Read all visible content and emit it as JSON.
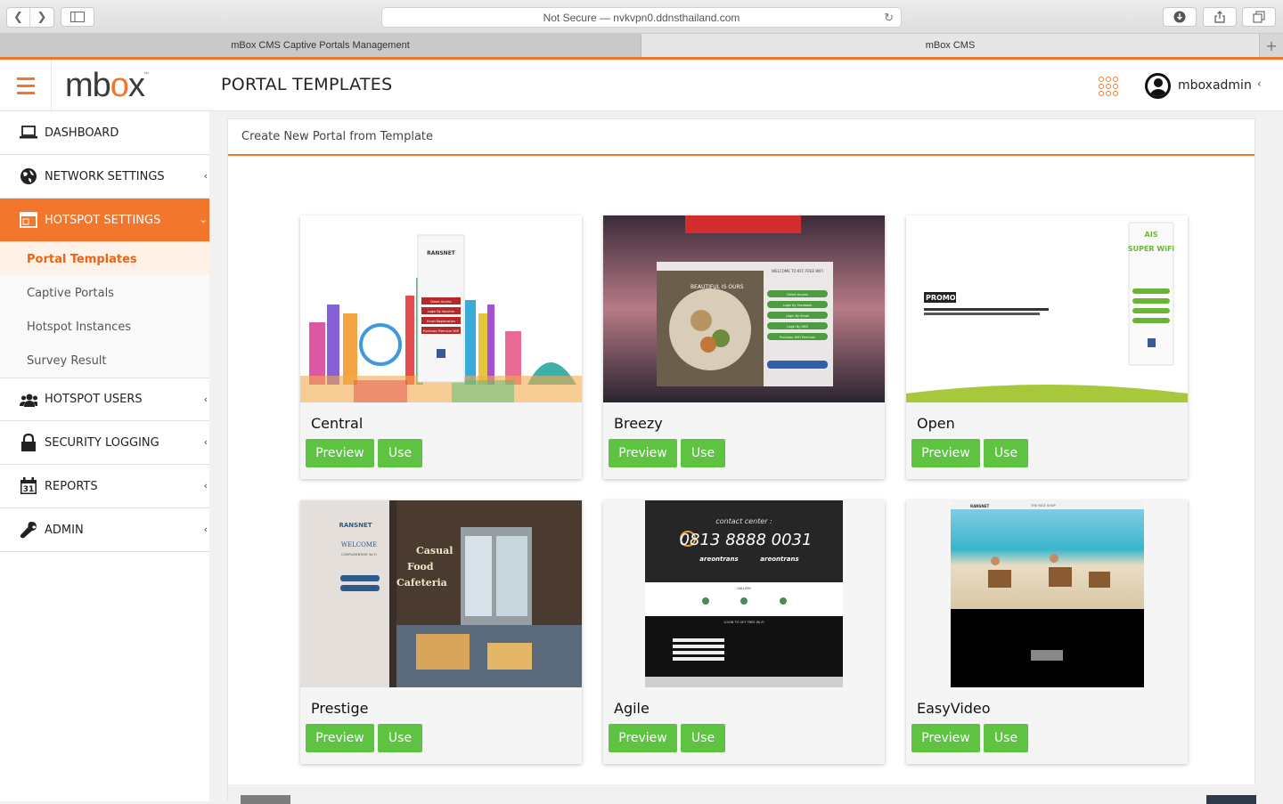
{
  "browser": {
    "url": "Not Secure — nvkvpn0.ddnsthailand.com",
    "tabs": [
      {
        "label": "mBox CMS Captive Portals Management"
      },
      {
        "label": "mBox CMS"
      }
    ]
  },
  "header": {
    "logo": {
      "pre": "mb",
      "o": "o",
      "post": "x",
      "tm": "™"
    },
    "title": "PORTAL TEMPLATES",
    "username": "mboxadmin"
  },
  "sidebar": {
    "items": [
      {
        "label": "DASHBOARD",
        "icon": "laptop-icon"
      },
      {
        "label": "NETWORK SETTINGS",
        "icon": "globe-icon"
      },
      {
        "label": "HOTSPOT SETTINGS",
        "icon": "window-icon"
      },
      {
        "label": "HOTSPOT USERS",
        "icon": "users-icon"
      },
      {
        "label": "SECURITY LOGGING",
        "icon": "lock-icon"
      },
      {
        "label": "REPORTS",
        "icon": "calendar-icon",
        "icon_text": "31"
      },
      {
        "label": "ADMIN",
        "icon": "wrench-icon"
      }
    ],
    "submenu": [
      {
        "label": "Portal Templates"
      },
      {
        "label": "Captive Portals"
      },
      {
        "label": "Hotspot Instances"
      },
      {
        "label": "Survey Result"
      }
    ]
  },
  "panel": {
    "heading": "Create New Portal from Template"
  },
  "templates": [
    {
      "name": "Central",
      "preview": "Preview",
      "use": "Use",
      "thumb": {
        "title": "RANSNET",
        "buttons": [
          "Direct Access",
          "Login By Voucher",
          "Email Registration",
          "Purchase Premium WiFi"
        ]
      }
    },
    {
      "name": "Breezy",
      "preview": "Preview",
      "use": "Use",
      "thumb": {
        "title": "WELCOME TO KFC FREE WIFI",
        "banner": "BEAUTIFUL IS OURS",
        "buttons": [
          "Direct Access",
          "Login By Facebook",
          "Login By Email",
          "Login By SMS",
          "Purchase WiFi Premium"
        ]
      }
    },
    {
      "name": "Open",
      "preview": "Preview",
      "use": "Use",
      "thumb": {
        "promo": "PROMO 1",
        "brand": "AIS",
        "brand2": "SUPER WiFi"
      }
    },
    {
      "name": "Prestige",
      "preview": "Preview",
      "use": "Use",
      "thumb": {
        "brand": "RANSNET",
        "welcome": "WELCOME",
        "sub": "COMPLIMENTARY WI-FI",
        "sign": [
          "Casual",
          "Food",
          "Cafeteria"
        ]
      }
    },
    {
      "name": "Agile",
      "preview": "Preview",
      "use": "Use",
      "thumb": {
        "contact": "contact center :",
        "phone": "0813 8888 0031",
        "social1": "areontrans",
        "social2": "areontrans",
        "gallery": "GALLERY",
        "login": "LOGIN TO GET FREE WI-FI"
      }
    },
    {
      "name": "EasyVideo",
      "preview": "Preview",
      "use": "Use",
      "thumb": {
        "brand": "RANSNET",
        "partner": "THE FACE SHOP"
      }
    }
  ],
  "colors": {
    "accent": "#f2762b",
    "button_green": "#5ec341",
    "active_sub_text": "#e8651a"
  }
}
